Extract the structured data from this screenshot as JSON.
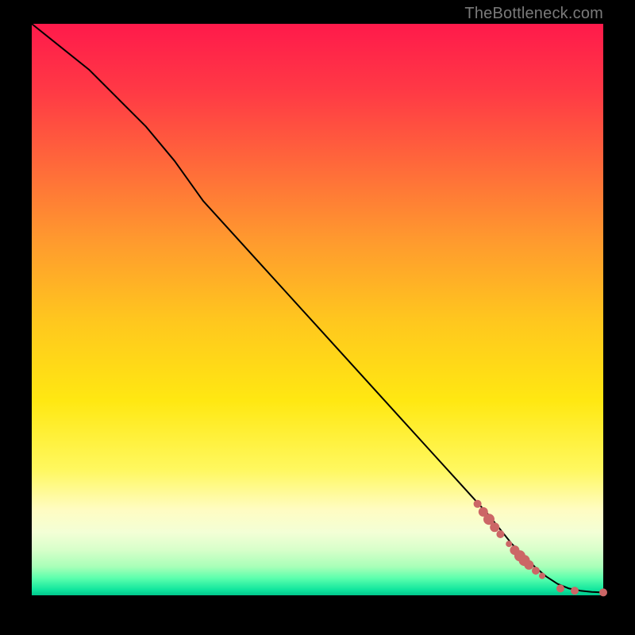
{
  "attribution": "TheBottleneck.com",
  "colors": {
    "dot": "#cc6666",
    "curve": "#000000"
  },
  "chart_data": {
    "type": "line",
    "title": "",
    "xlabel": "",
    "ylabel": "",
    "xlim": [
      0,
      100
    ],
    "ylim": [
      0,
      100
    ],
    "grid": false,
    "series": [
      {
        "name": "curve",
        "x": [
          0,
          5,
          10,
          15,
          20,
          25,
          30,
          35,
          40,
          45,
          50,
          55,
          60,
          65,
          70,
          75,
          80,
          82,
          84,
          86,
          88,
          90,
          92,
          94,
          96,
          98,
          100
        ],
        "y": [
          100,
          96,
          92,
          87,
          82,
          76,
          69,
          63.5,
          58,
          52.5,
          47,
          41.5,
          36,
          30.5,
          25,
          19.5,
          14,
          11.5,
          9,
          7,
          5,
          3.3,
          2,
          1.2,
          0.8,
          0.6,
          0.5
        ]
      }
    ],
    "points": [
      {
        "x": 78,
        "y": 16.0,
        "r": 5
      },
      {
        "x": 79,
        "y": 14.6,
        "r": 6
      },
      {
        "x": 80,
        "y": 13.3,
        "r": 7
      },
      {
        "x": 81,
        "y": 11.9,
        "r": 6
      },
      {
        "x": 82,
        "y": 10.7,
        "r": 5
      },
      {
        "x": 83.5,
        "y": 9.0,
        "r": 4
      },
      {
        "x": 84.5,
        "y": 7.9,
        "r": 6
      },
      {
        "x": 85.4,
        "y": 6.9,
        "r": 7
      },
      {
        "x": 86.2,
        "y": 6.1,
        "r": 7
      },
      {
        "x": 87.0,
        "y": 5.3,
        "r": 6
      },
      {
        "x": 88.2,
        "y": 4.3,
        "r": 5
      },
      {
        "x": 89.3,
        "y": 3.4,
        "r": 4
      },
      {
        "x": 92.5,
        "y": 1.2,
        "r": 5
      },
      {
        "x": 95.0,
        "y": 0.8,
        "r": 5
      },
      {
        "x": 100,
        "y": 0.5,
        "r": 5
      }
    ]
  }
}
